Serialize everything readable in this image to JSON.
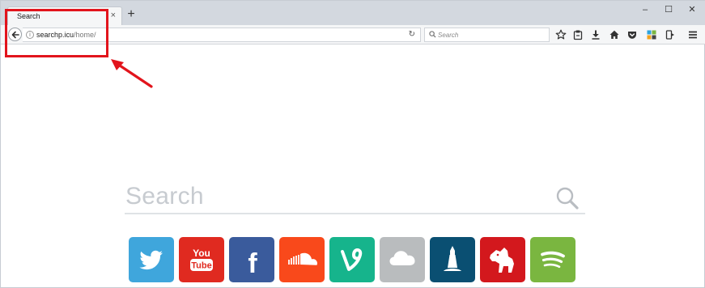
{
  "browser": {
    "tab_title": "Search",
    "tab_close": "×",
    "new_tab": "+",
    "window_controls": {
      "minimize": "–",
      "maximize": "☐",
      "close": "✕"
    },
    "url": {
      "host": "searchp.icu",
      "path": "/home/"
    },
    "reload": "↻",
    "search_placeholder": "Search",
    "toolbar_icons": [
      "star-icon",
      "clipboard-icon",
      "download-icon",
      "home-icon",
      "pocket-icon",
      "extension-icon",
      "sync-icon",
      "menu-icon"
    ]
  },
  "page": {
    "search_placeholder": "Search",
    "tiles": [
      {
        "name": "twitter",
        "color": "#3fa6dc"
      },
      {
        "name": "youtube",
        "color": "#e02a20",
        "label_top": "You",
        "label_bottom": "Tube"
      },
      {
        "name": "facebook",
        "color": "#3a5b9c",
        "label": "f"
      },
      {
        "name": "soundcloud",
        "color": "#f9491b"
      },
      {
        "name": "vine",
        "color": "#16b48c",
        "label": "V"
      },
      {
        "name": "cloud",
        "color": "#b9bcbe"
      },
      {
        "name": "lighthouse",
        "color": "#0a4f72"
      },
      {
        "name": "zynga",
        "color": "#d3181d"
      },
      {
        "name": "spotify",
        "color": "#7ab640"
      }
    ]
  },
  "annotation": {
    "box_color": "#e2141c"
  }
}
